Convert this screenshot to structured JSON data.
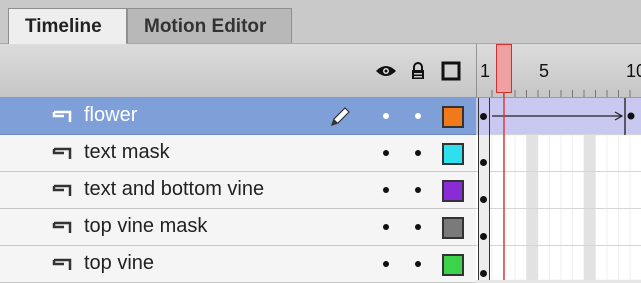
{
  "tabs": [
    {
      "label": "Timeline",
      "active": true
    },
    {
      "label": "Motion Editor",
      "active": false
    }
  ],
  "header_icons": [
    "eye-icon",
    "lock-icon",
    "outline-icon"
  ],
  "ruler": {
    "labels": [
      "1",
      "5",
      "10"
    ],
    "current_frame": 1
  },
  "layers": [
    {
      "name": "flower",
      "selected": true,
      "color": "#f07a1a",
      "editing": true
    },
    {
      "name": "text mask",
      "selected": false,
      "color": "#2ee0ee",
      "editing": false
    },
    {
      "name": "text and bottom vine",
      "selected": false,
      "color": "#8a2bd8",
      "editing": false
    },
    {
      "name": "top vine mask",
      "selected": false,
      "color": "#7a7a7a",
      "editing": false
    },
    {
      "name": "top vine",
      "selected": false,
      "color": "#3cd24a",
      "editing": false
    }
  ],
  "colors": {
    "selection": "#7f9fd8",
    "playhead": "#ee5a5a",
    "tween": "#c8c8f0"
  }
}
